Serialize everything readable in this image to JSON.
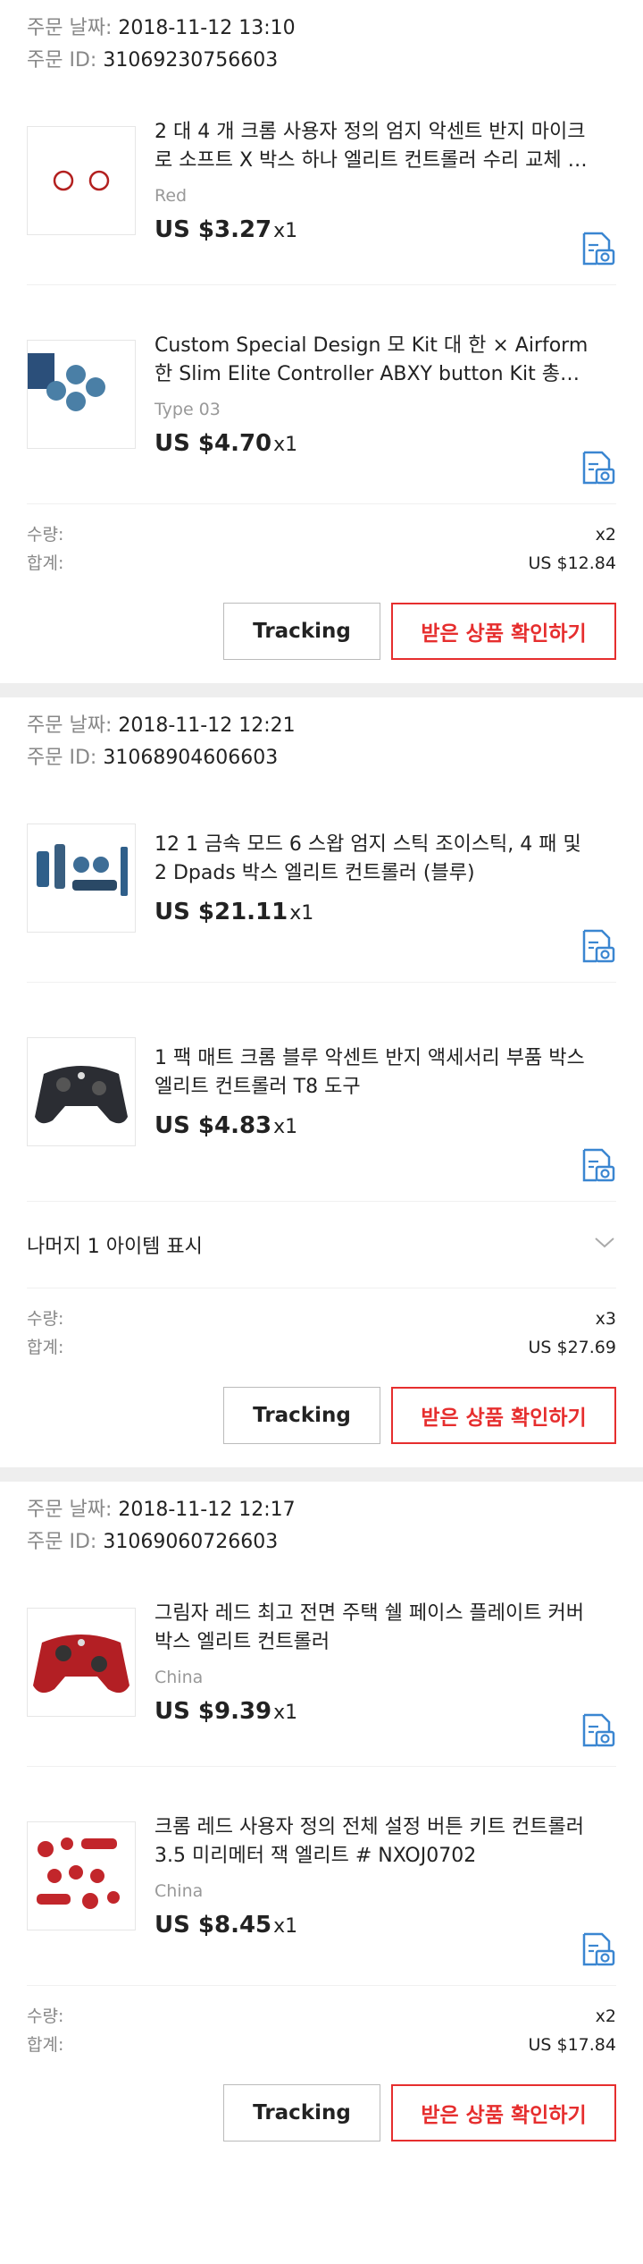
{
  "labels": {
    "order_date": "주문 날짜:",
    "order_id": "주문 ID:",
    "quantity": "수량:",
    "total": "합계:",
    "tracking": "Tracking",
    "confirm": "받은 상품 확인하기"
  },
  "orders": [
    {
      "date": "2018-11-12 13:10",
      "id": "31069230756603",
      "items": [
        {
          "title": "2 대 4 개 크롬 사용자 정의 엄지 악센트 반지 마이크로 소프트 X 박스 하나 엘리트 컨트롤러 수리 교체 부품",
          "variant": "Red",
          "price": "US $3.27",
          "qty": "x1",
          "icon": "review-photo-icon"
        },
        {
          "title": "Custom Special Design 모 Kit 대 한 × Airform 한 Slim Elite Controller ABXY button Kit 총알 Bu...",
          "variant": "Type 03",
          "price": "US $4.70",
          "qty": "x1",
          "icon": "review-photo-icon"
        }
      ],
      "sum_qty": "x2",
      "sum_total": "US $12.84"
    },
    {
      "date": "2018-11-12 12:21",
      "id": "31068904606603",
      "items": [
        {
          "title": "12 1 금속 모드 6 스왑 엄지 스틱 조이스틱, 4 패 및 2 Dpads 박스 엘리트 컨트롤러 (블루)",
          "variant": "",
          "price": "US $21.11",
          "qty": "x1",
          "icon": "review-photo-icon"
        },
        {
          "title": "1 팩 매트 크롬 블루 악센트 반지 액세서리 부품 박스 엘리트 컨트롤러 T8 도구",
          "variant": "",
          "price": "US $4.83",
          "qty": "x1",
          "icon": "review-photo-icon"
        }
      ],
      "more": "나머지 1 아이템 표시",
      "sum_qty": "x3",
      "sum_total": "US $27.69"
    },
    {
      "date": "2018-11-12 12:17",
      "id": "31069060726603",
      "items": [
        {
          "title": "그림자 레드 최고 전면 주택 쉘 페이스 플레이트 커버 박스 엘리트 컨트롤러",
          "variant": "China",
          "price": "US $9.39",
          "qty": "x1",
          "icon": "review-photo-icon"
        },
        {
          "title": "크롬 레드 사용자 정의 전체 설정 버튼 키트 컨트롤러 3.5 미리메터 잭 엘리트 # NXOJ0702",
          "variant": "China",
          "price": "US $8.45",
          "qty": "x1",
          "icon": "review-photo-icon"
        }
      ],
      "sum_qty": "x2",
      "sum_total": "US $17.84"
    }
  ],
  "colors": {
    "accent": "#e62e2e",
    "icon_blue": "#3a86d1",
    "separator": "#eeeeee"
  }
}
